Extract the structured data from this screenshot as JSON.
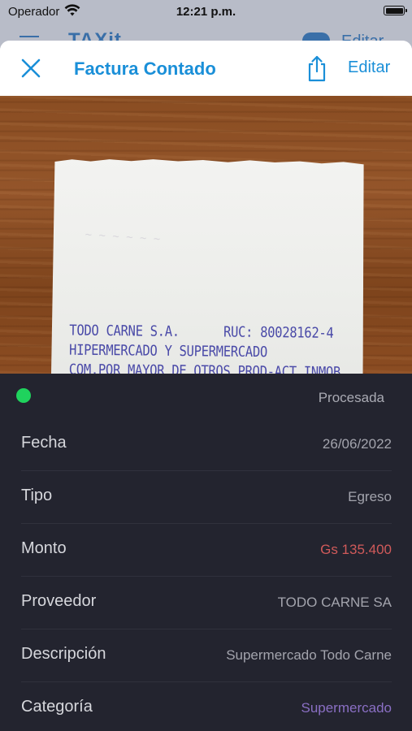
{
  "status_bar": {
    "carrier": "Operador",
    "time": "12:21 p.m."
  },
  "background_app": {
    "logo": "TAXit",
    "edit_label": "Editar"
  },
  "nav": {
    "title": "Factura Contado",
    "edit_label": "Editar",
    "close_icon": "close-icon",
    "share_icon": "share-icon"
  },
  "receipt": {
    "lines": [
      "TODO CARNE S.A.      RUC: 80028162-4",
      "HIPERMERCADO Y SUPERMERCADO",
      "COM.POR MAYOR DE OTROS PROD-ACT INMOB"
    ]
  },
  "details": {
    "status": "Procesada",
    "status_color": "#1fd35d",
    "fields": [
      {
        "label": "Fecha",
        "value": "26/06/2022"
      },
      {
        "label": "Tipo",
        "value": "Egreso"
      },
      {
        "label": "Monto",
        "value": "Gs 135.400",
        "color": "#d05a5a"
      },
      {
        "label": "Proveedor",
        "value": "TODO CARNE SA"
      },
      {
        "label": "Descripción",
        "value": "Supermercado Todo Carne"
      },
      {
        "label": "Categoría",
        "value": "Supermercado",
        "color": "#8a6fc4"
      }
    ]
  }
}
